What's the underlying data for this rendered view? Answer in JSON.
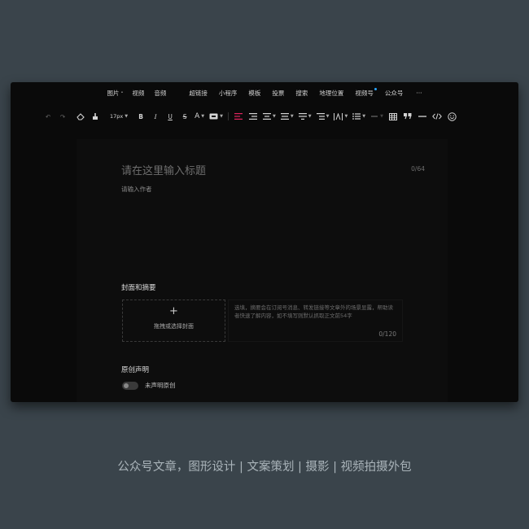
{
  "insert_toolbar": {
    "items": [
      {
        "label": "图片",
        "caret": "•"
      },
      {
        "label": "视频"
      },
      {
        "label": "音频"
      },
      {
        "label": "超链接"
      },
      {
        "label": "小程序"
      },
      {
        "label": "模板"
      },
      {
        "label": "投票"
      },
      {
        "label": "搜索"
      },
      {
        "label": "地理位置"
      },
      {
        "label": "视频号"
      },
      {
        "label": "公众号"
      },
      {
        "label": "···"
      }
    ]
  },
  "format_toolbar": {
    "undo": "↶",
    "redo": "↷",
    "font_size": "17px",
    "bold": "B",
    "italic": "I",
    "underline": "U",
    "strike": "S",
    "font_color": "A",
    "accent_color": "#e0245e"
  },
  "editor": {
    "title_placeholder": "请在这里输入标题",
    "title_count": "0/64",
    "author_placeholder": "请输入作者",
    "cover_section_title": "封面和摘要",
    "cover_plus": "+",
    "cover_label": "拖拽或选择封面",
    "summary_placeholder": "选填，摘要会在订阅号消息、转发链接等文章外的场景显露，帮助读者快速了解内容，如不填写则默认抓取正文前54字",
    "summary_count": "0/120",
    "original_section_title": "原创声明",
    "original_toggle_label": "未声明原创"
  },
  "caption": "公众号文章，图形设计 | 文案策划 | 摄影 | 视频拍摄外包"
}
